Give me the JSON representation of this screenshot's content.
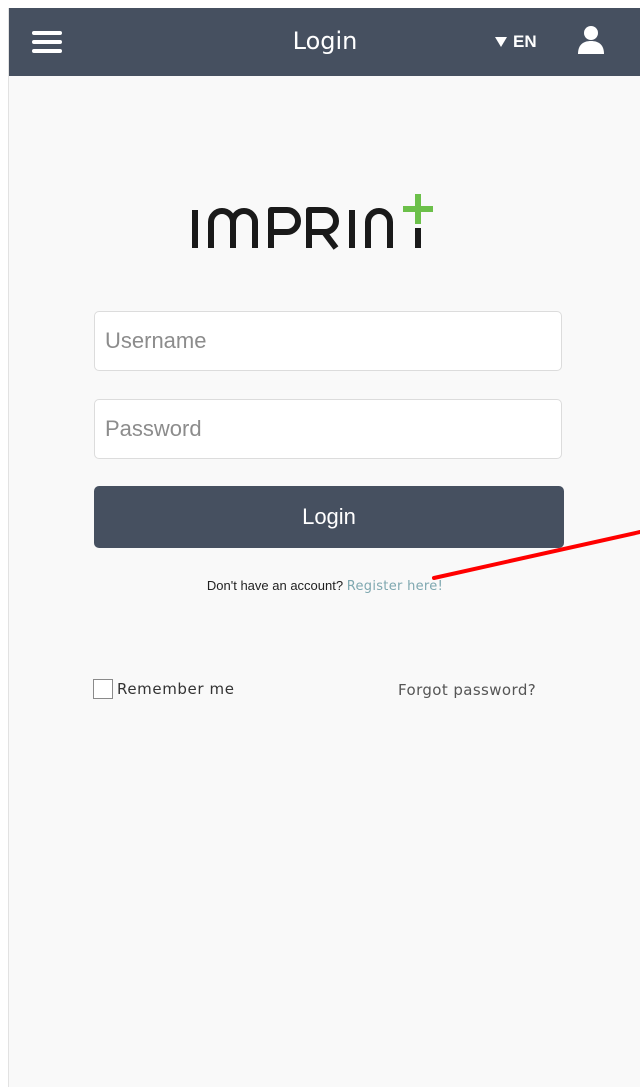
{
  "header": {
    "title": "Login",
    "language": "EN",
    "menu_icon": "hamburger-menu-icon",
    "language_caret_icon": "caret-down-icon",
    "user_icon": "user-icon",
    "background_color": "#465060"
  },
  "logo": {
    "text": "IMPRINT",
    "accent_color": "#6cc04a"
  },
  "form": {
    "username_placeholder": "Username",
    "password_placeholder": "Password",
    "login_button": "Login",
    "register_prompt": "Don't have an account?",
    "register_link": "Register here!",
    "remember_me": "Remember me",
    "remember_checked": false,
    "forgot_password": "Forgot password?"
  },
  "annotation": {
    "type": "red-arrow",
    "color": "#ff0000",
    "target": "register-link"
  }
}
